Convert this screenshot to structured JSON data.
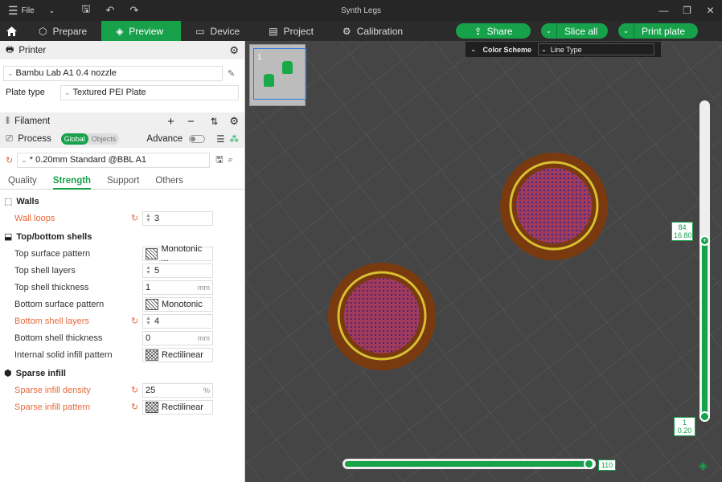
{
  "app": {
    "title": "Synth Legs",
    "file_label": "File"
  },
  "nav": {
    "tabs": [
      {
        "label": "Prepare"
      },
      {
        "label": "Preview"
      },
      {
        "label": "Device"
      },
      {
        "label": "Project"
      },
      {
        "label": "Calibration"
      }
    ]
  },
  "actions": {
    "share": "Share",
    "slice_all": "Slice all",
    "print_plate": "Print plate"
  },
  "colors": {
    "accent": "#17a14b",
    "modified": "#e8683a",
    "extrusion": "#7a3a10",
    "infill": "#a23a5a",
    "wall": "#d8c030"
  },
  "printer": {
    "header": "Printer",
    "name": "Bambu Lab A1 0.4 nozzle",
    "plate_type_label": "Plate type",
    "plate_type": "Textured PEI Plate"
  },
  "filament": {
    "header": "Filament"
  },
  "process": {
    "header": "Process",
    "toggle_global": "Global",
    "toggle_objects": "Objects",
    "advance_label": "Advance",
    "profile": "* 0.20mm Standard @BBL A1"
  },
  "tabs": [
    {
      "label": "Quality"
    },
    {
      "label": "Strength"
    },
    {
      "label": "Support"
    },
    {
      "label": "Others"
    }
  ],
  "groups": {
    "walls": {
      "title": "Walls",
      "options": [
        {
          "label": "Wall loops",
          "value": "3"
        }
      ]
    },
    "shells": {
      "title": "Top/bottom shells",
      "options": [
        {
          "label": "Top surface pattern",
          "value": "Monotonic ..."
        },
        {
          "label": "Top shell layers",
          "value": "5"
        },
        {
          "label": "Top shell thickness",
          "value": "1",
          "unit": "mm"
        },
        {
          "label": "Bottom surface pattern",
          "value": "Monotonic"
        },
        {
          "label": "Bottom shell layers",
          "value": "4"
        },
        {
          "label": "Bottom shell thickness",
          "value": "0",
          "unit": "mm"
        },
        {
          "label": "Internal solid infill pattern",
          "value": "Rectilinear"
        }
      ]
    },
    "infill": {
      "title": "Sparse infill",
      "options": [
        {
          "label": "Sparse infill density",
          "value": "25",
          "unit": "%"
        },
        {
          "label": "Sparse infill pattern",
          "value": "Rectilinear"
        }
      ]
    }
  },
  "viewport": {
    "plate_number": "1",
    "color_scheme_label": "Color Scheme",
    "color_scheme_value": "Line Type",
    "layer_top": {
      "layer": "84",
      "height": "16.80"
    },
    "layer_bottom": {
      "layer": "1",
      "height": "0.20"
    },
    "horizontal_slider_value": "110"
  }
}
